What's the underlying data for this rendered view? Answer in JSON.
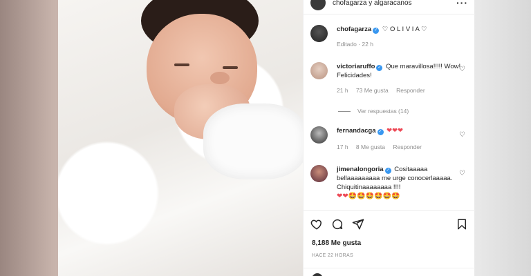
{
  "header": {
    "username_line": "chofagarza y algaracanos"
  },
  "caption": {
    "username": "chofagarza",
    "text": "♡ O L I V I A ♡",
    "meta": "Editado · 22 h"
  },
  "comments": [
    {
      "username": "victoriaruffo",
      "text": "Que maravillosa!!!!! Wow! Felicidades!",
      "time": "21 h",
      "likes": "73 Me gusta",
      "reply": "Responder"
    },
    {
      "username": "fernandacga",
      "text": "❤❤❤",
      "time": "17 h",
      "likes": "8 Me gusta",
      "reply": "Responder"
    },
    {
      "username": "jimenalongoria",
      "text": "Cositaaaaa bellaaaaaaaaa me urge conocerlaaaaa. Chiquitinaaaaaaaa !!!!",
      "emojis": "❤❤🤩🤩🤩🤩🤩🤩"
    }
  ],
  "view_replies": "Ver respuestas (14)",
  "likes_count": "8,188 Me gusta",
  "posted_ago": "HACE 22 HORAS",
  "icons": {
    "like": "heart-icon",
    "comment": "comment-icon",
    "share": "share-icon",
    "save": "bookmark-icon",
    "more": "more-options-icon"
  },
  "colors": {
    "verified": "#3897f0",
    "heart_red": "#ed4956",
    "muted": "#8e8e8e"
  }
}
